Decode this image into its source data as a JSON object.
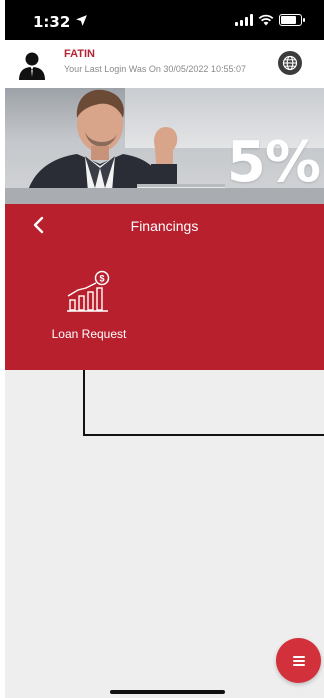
{
  "status_bar": {
    "time": "1:32"
  },
  "user": {
    "name": "FATIN",
    "last_login": "Your Last Login Was On 30/05/2022 10:55:07"
  },
  "banner": {
    "percentage": "5%"
  },
  "financings": {
    "title": "Financings",
    "items": [
      {
        "label": "Loan Request",
        "icon": "loan-growth-chart-icon"
      }
    ]
  },
  "colors": {
    "brand_red": "#b8202e",
    "fab_red": "#d2313c",
    "name_red": "#b32434",
    "content_bg": "#eeeeee"
  },
  "icons": {
    "avatar": "user-avatar-icon",
    "globe": "globe-icon",
    "back": "chevron-left-icon",
    "fab": "menu-icon"
  }
}
